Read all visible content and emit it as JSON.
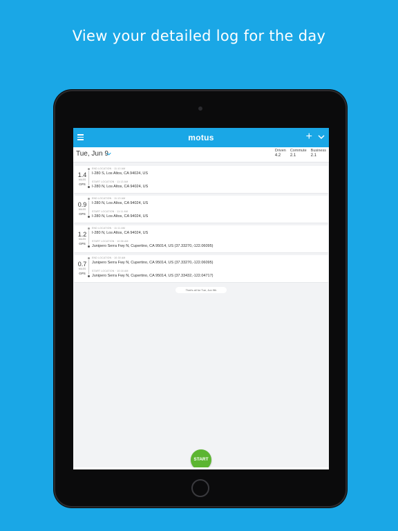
{
  "headline": "View your detailed log for the day",
  "app": {
    "logo": "motus",
    "date": "Tue, Jun 9",
    "totals": [
      {
        "label": "Driven",
        "value": "4.2"
      },
      {
        "label": "Commute",
        "value": "2.1"
      },
      {
        "label": "Business",
        "value": "2.1"
      }
    ],
    "trips": [
      {
        "miles": "1.4",
        "unit": "MILES",
        "source": "GPS",
        "end_caption": "END LOCATION  ·  11:10 AM",
        "end_address": "I-280 S, Los Altos, CA 94024, US",
        "start_caption": "START LOCATION  ·  11:13 AM",
        "start_address": "I-280 N, Los Altos, CA 94024, US"
      },
      {
        "miles": "0.9",
        "unit": "MILES",
        "source": "GPS",
        "end_caption": "END LOCATION  ·  11:13 AM",
        "end_address": "I-280 N, Los Altos, CA 94024, US",
        "start_caption": "START LOCATION  ·  11:11 AM",
        "start_address": "I-280 N, Los Altos, CA 94024, US"
      },
      {
        "miles": "1.2",
        "unit": "MILES",
        "source": "GPS",
        "end_caption": "END LOCATION  ·  11:11 AM",
        "end_address": "I-280 N, Los Altos, CA 94024, US",
        "start_caption": "START LOCATION  ·  10:56 AM",
        "start_address": "Junipero Serra Fwy N, Cupertino, CA 95014, US (37.33270,-122.06095)"
      },
      {
        "miles": "0.7",
        "unit": "MILES",
        "source": "GPS",
        "end_caption": "END LOCATION  ·  10:30 AM",
        "end_address": "Junipero Serra Fwy N, Cupertino, CA 95014, US (37.33270,-122.06095)",
        "start_caption": "START LOCATION  ·  10:16 AM",
        "start_address": "Junipero Serra Fwy N, Cupertino, CA 95014, US (37.33432,-122.04717)"
      }
    ],
    "footer_note": "That's all for Tue, Jun 9th",
    "start_label": "START"
  },
  "colors": {
    "background": "#1aa7e6",
    "topbar": "#1aa7e6",
    "start_button": "#5cb531"
  }
}
